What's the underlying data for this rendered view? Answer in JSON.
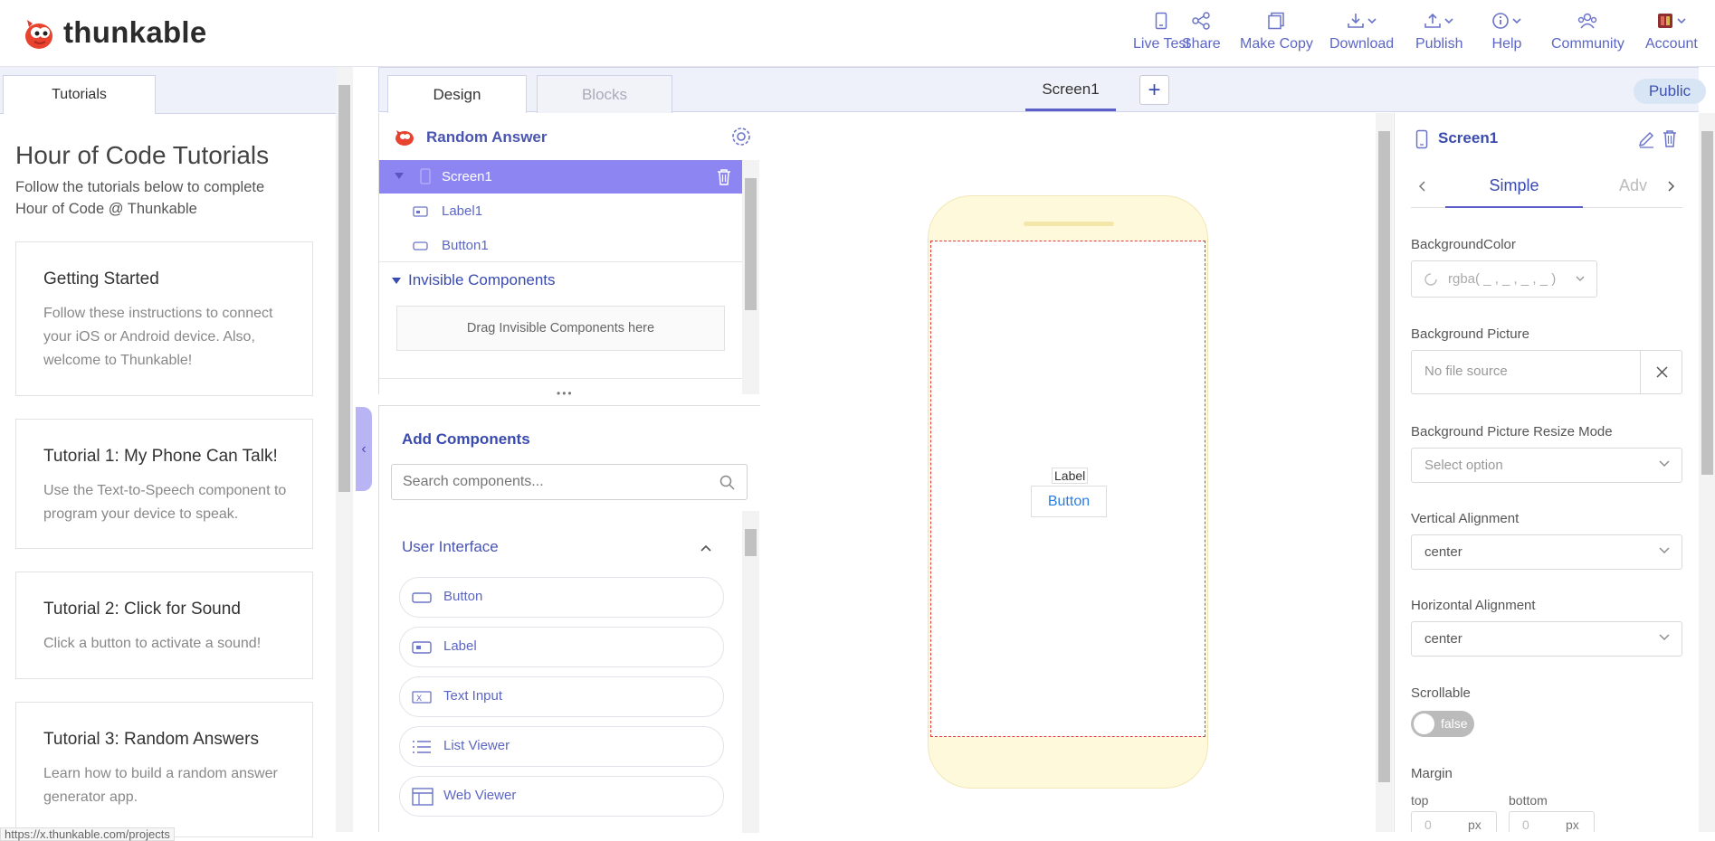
{
  "app": {
    "name": "thunkable"
  },
  "nav": {
    "live_test": "Live Test",
    "share": "Share",
    "make_copy": "Make Copy",
    "download": "Download",
    "publish": "Publish",
    "help": "Help",
    "community": "Community",
    "account": "Account"
  },
  "tutorials": {
    "tab": "Tutorials",
    "title": "Hour of Code Tutorials",
    "subtitle": "Follow the tutorials below to complete Hour of Code @ Thunkable",
    "cards": [
      {
        "title": "Getting Started",
        "desc": "Follow these instructions to connect your iOS or Android device. Also, welcome to Thunkable!"
      },
      {
        "title": "Tutorial 1: My Phone Can Talk!",
        "desc": "Use the Text-to-Speech component to program your device to speak."
      },
      {
        "title": "Tutorial 2: Click for Sound",
        "desc": "Click a button to activate a sound!"
      },
      {
        "title": "Tutorial 3: Random Answers",
        "desc": "Learn how to build a random answer generator app."
      }
    ]
  },
  "editor": {
    "tab_design": "Design",
    "tab_blocks": "Blocks",
    "screen_tab": "Screen1",
    "add_screen": "+",
    "public": "Public"
  },
  "tree": {
    "project_name": "Random Answer",
    "items": [
      {
        "label": "Screen1"
      },
      {
        "label": "Label1"
      },
      {
        "label": "Button1"
      }
    ],
    "invisible_title": "Invisible Components",
    "invisible_drop": "Drag Invisible Components here"
  },
  "components": {
    "title": "Add Components",
    "search_placeholder": "Search components...",
    "category": "User Interface",
    "items": [
      {
        "label": "Button"
      },
      {
        "label": "Label"
      },
      {
        "label": "Text Input"
      },
      {
        "label": "List Viewer"
      },
      {
        "label": "Web Viewer"
      }
    ]
  },
  "canvas": {
    "label": "Label",
    "button": "Button"
  },
  "properties": {
    "title": "Screen1",
    "tab_simple": "Simple",
    "tab_advanced": "Adv",
    "background_color_label": "BackgroundColor",
    "background_color_value": "rgba( _ , _ , _ , _ )",
    "background_picture_label": "Background Picture",
    "background_picture_value": "No file source",
    "resize_mode_label": "Background Picture Resize Mode",
    "resize_mode_value": "Select option",
    "vertical_alignment_label": "Vertical Alignment",
    "vertical_alignment_value": "center",
    "horizontal_alignment_label": "Horizontal Alignment",
    "horizontal_alignment_value": "center",
    "scrollable_label": "Scrollable",
    "scrollable_value": "false",
    "margin_label": "Margin",
    "margin_top_label": "top",
    "margin_bottom_label": "bottom",
    "margin_top_value": "0",
    "margin_bottom_value": "0",
    "margin_unit": "px"
  },
  "status": {
    "url": "https://x.thunkable.com/projects"
  },
  "colors": {
    "accent": "#5c66c4",
    "selection": "#8d86f2",
    "phone": "#fff9db"
  }
}
